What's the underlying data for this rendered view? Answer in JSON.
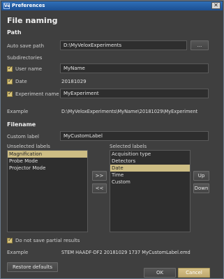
{
  "window": {
    "title": "Preferences",
    "app_icon": "Ve",
    "close_glyph": "✕"
  },
  "page": {
    "title": "File naming"
  },
  "path": {
    "heading": "Path",
    "auto_save_label": "Auto save path",
    "auto_save_value": "D:\\MyVeloxExperiments",
    "browse_label": "...",
    "subdirectories_label": "Subdirectories",
    "user_name_label": "User name",
    "user_name_value": "MyName",
    "date_label": "Date",
    "date_value": "20181029",
    "experiment_name_label": "Experiment name",
    "experiment_name_value": "MyExperiment",
    "example_label": "Example",
    "example_value": "D:\\MyVeloxExperiments\\MyName\\20181029\\MyExperiment"
  },
  "filename": {
    "heading": "Filename",
    "custom_label_label": "Custom label",
    "custom_label_value": "MyCustomLabel",
    "unselected_heading": "Unselected labels",
    "selected_heading": "Selected labels",
    "unselected_items": [
      "Magnification",
      "Probe Mode",
      "Projector Mode"
    ],
    "selected_items": [
      "Acquisition type",
      "Detectors",
      "Date",
      "Time",
      "Custom"
    ],
    "add_label": ">>",
    "remove_label": "<<",
    "up_label": "Up",
    "down_label": "Down",
    "do_not_save_label": "Do not save partial results",
    "example_label": "Example",
    "example_value": "STEM HAADF-DF2 20181029 1737 MyCustomLabel.emd"
  },
  "footer": {
    "restore_label": "Restore defaults",
    "ok_label": "OK",
    "cancel_label": "Cancel"
  },
  "colors": {
    "accent": "#cdbd84",
    "title_bar": "#1c4f92",
    "background": "#3f3f3f"
  }
}
